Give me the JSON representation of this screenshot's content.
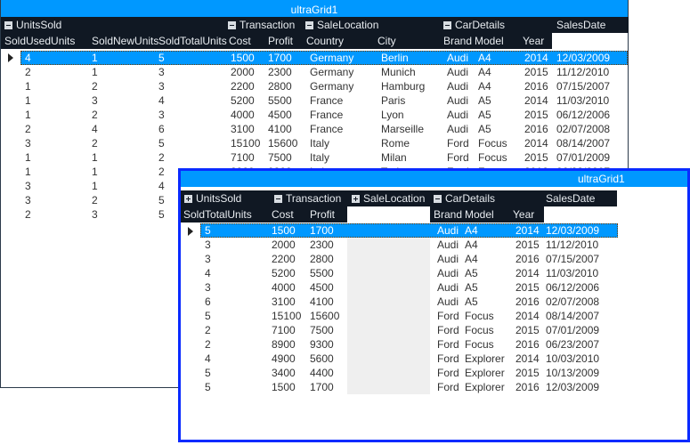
{
  "grid1": {
    "title": "ultraGrid1",
    "groups": [
      {
        "label": "UnitsSold",
        "state": "expanded"
      },
      {
        "label": "Transaction",
        "state": "expanded"
      },
      {
        "label": "SaleLocation",
        "state": "expanded"
      },
      {
        "label": "CarDetails",
        "state": "expanded"
      },
      {
        "label": "SalesDate",
        "state": "none"
      }
    ],
    "columns": [
      "SoldUsedUnits",
      "SoldNewUnits",
      "SoldTotalUnits",
      "Cost",
      "Profit",
      "Country",
      "City",
      "Brand",
      "Model",
      "Year"
    ],
    "rows": [
      [
        "4",
        "1",
        "5",
        "1500",
        "1700",
        "Germany",
        "Berlin",
        "Audi",
        "A4",
        "2014",
        "12/03/2009"
      ],
      [
        "2",
        "1",
        "3",
        "2000",
        "2300",
        "Germany",
        "Munich",
        "Audi",
        "A4",
        "2015",
        "11/12/2010"
      ],
      [
        "1",
        "2",
        "3",
        "2200",
        "2800",
        "Germany",
        "Hamburg",
        "Audi",
        "A4",
        "2016",
        "07/15/2007"
      ],
      [
        "1",
        "3",
        "4",
        "5200",
        "5500",
        "France",
        "Paris",
        "Audi",
        "A5",
        "2014",
        "11/03/2010"
      ],
      [
        "1",
        "2",
        "3",
        "4000",
        "4500",
        "France",
        "Lyon",
        "Audi",
        "A5",
        "2015",
        "06/12/2006"
      ],
      [
        "2",
        "4",
        "6",
        "3100",
        "4100",
        "France",
        "Marseille",
        "Audi",
        "A5",
        "2016",
        "02/07/2008"
      ],
      [
        "3",
        "2",
        "5",
        "15100",
        "15600",
        "Italy",
        "Rome",
        "Ford",
        "Focus",
        "2014",
        "08/14/2007"
      ],
      [
        "1",
        "1",
        "2",
        "7100",
        "7500",
        "Italy",
        "Milan",
        "Ford",
        "Focus",
        "2015",
        "07/01/2009"
      ],
      [
        "1",
        "1",
        "2",
        "8900",
        "9300",
        "Italy",
        "Turin",
        "Ford",
        "Focus",
        "2016",
        "06/23/2007"
      ],
      [
        "3",
        "1",
        "4",
        "",
        "",
        "",
        "",
        "",
        "",
        "",
        ""
      ],
      [
        "3",
        "2",
        "5",
        "",
        "",
        "",
        "",
        "",
        "",
        "",
        ""
      ],
      [
        "2",
        "3",
        "5",
        "",
        "",
        "",
        "",
        "",
        "",
        "",
        ""
      ]
    ],
    "selected_row": 0
  },
  "grid2": {
    "title": "ultraGrid1",
    "groups": [
      {
        "label": "UnitsSold",
        "state": "collapsed"
      },
      {
        "label": "Transaction",
        "state": "expanded"
      },
      {
        "label": "SaleLocation",
        "state": "collapsed"
      },
      {
        "label": "CarDetails",
        "state": "expanded"
      },
      {
        "label": "SalesDate",
        "state": "none"
      }
    ],
    "columns": [
      "SoldTotalUnits",
      "Cost",
      "Profit",
      "Brand",
      "Model",
      "Year"
    ],
    "rows": [
      [
        "5",
        "1500",
        "1700",
        "Audi",
        "A4",
        "2014",
        "12/03/2009"
      ],
      [
        "3",
        "2000",
        "2300",
        "Audi",
        "A4",
        "2015",
        "11/12/2010"
      ],
      [
        "3",
        "2200",
        "2800",
        "Audi",
        "A4",
        "2016",
        "07/15/2007"
      ],
      [
        "4",
        "5200",
        "5500",
        "Audi",
        "A5",
        "2014",
        "11/03/2010"
      ],
      [
        "3",
        "4000",
        "4500",
        "Audi",
        "A5",
        "2015",
        "06/12/2006"
      ],
      [
        "6",
        "3100",
        "4100",
        "Audi",
        "A5",
        "2016",
        "02/07/2008"
      ],
      [
        "5",
        "15100",
        "15600",
        "Ford",
        "Focus",
        "2014",
        "08/14/2007"
      ],
      [
        "2",
        "7100",
        "7500",
        "Ford",
        "Focus",
        "2015",
        "07/01/2009"
      ],
      [
        "2",
        "8900",
        "9300",
        "Ford",
        "Focus",
        "2016",
        "06/23/2007"
      ],
      [
        "4",
        "4900",
        "5600",
        "Ford",
        "Explorer",
        "2014",
        "10/03/2010"
      ],
      [
        "5",
        "3400",
        "4400",
        "Ford",
        "Explorer",
        "2015",
        "10/13/2009"
      ],
      [
        "5",
        "1500",
        "1700",
        "Ford",
        "Explorer",
        "2016",
        "12/03/2009"
      ]
    ],
    "selected_row": 0
  },
  "colors": {
    "caption": "#0098ff",
    "header": "#101823",
    "selection": "#0098ff",
    "active_border": "#0a2bff"
  }
}
